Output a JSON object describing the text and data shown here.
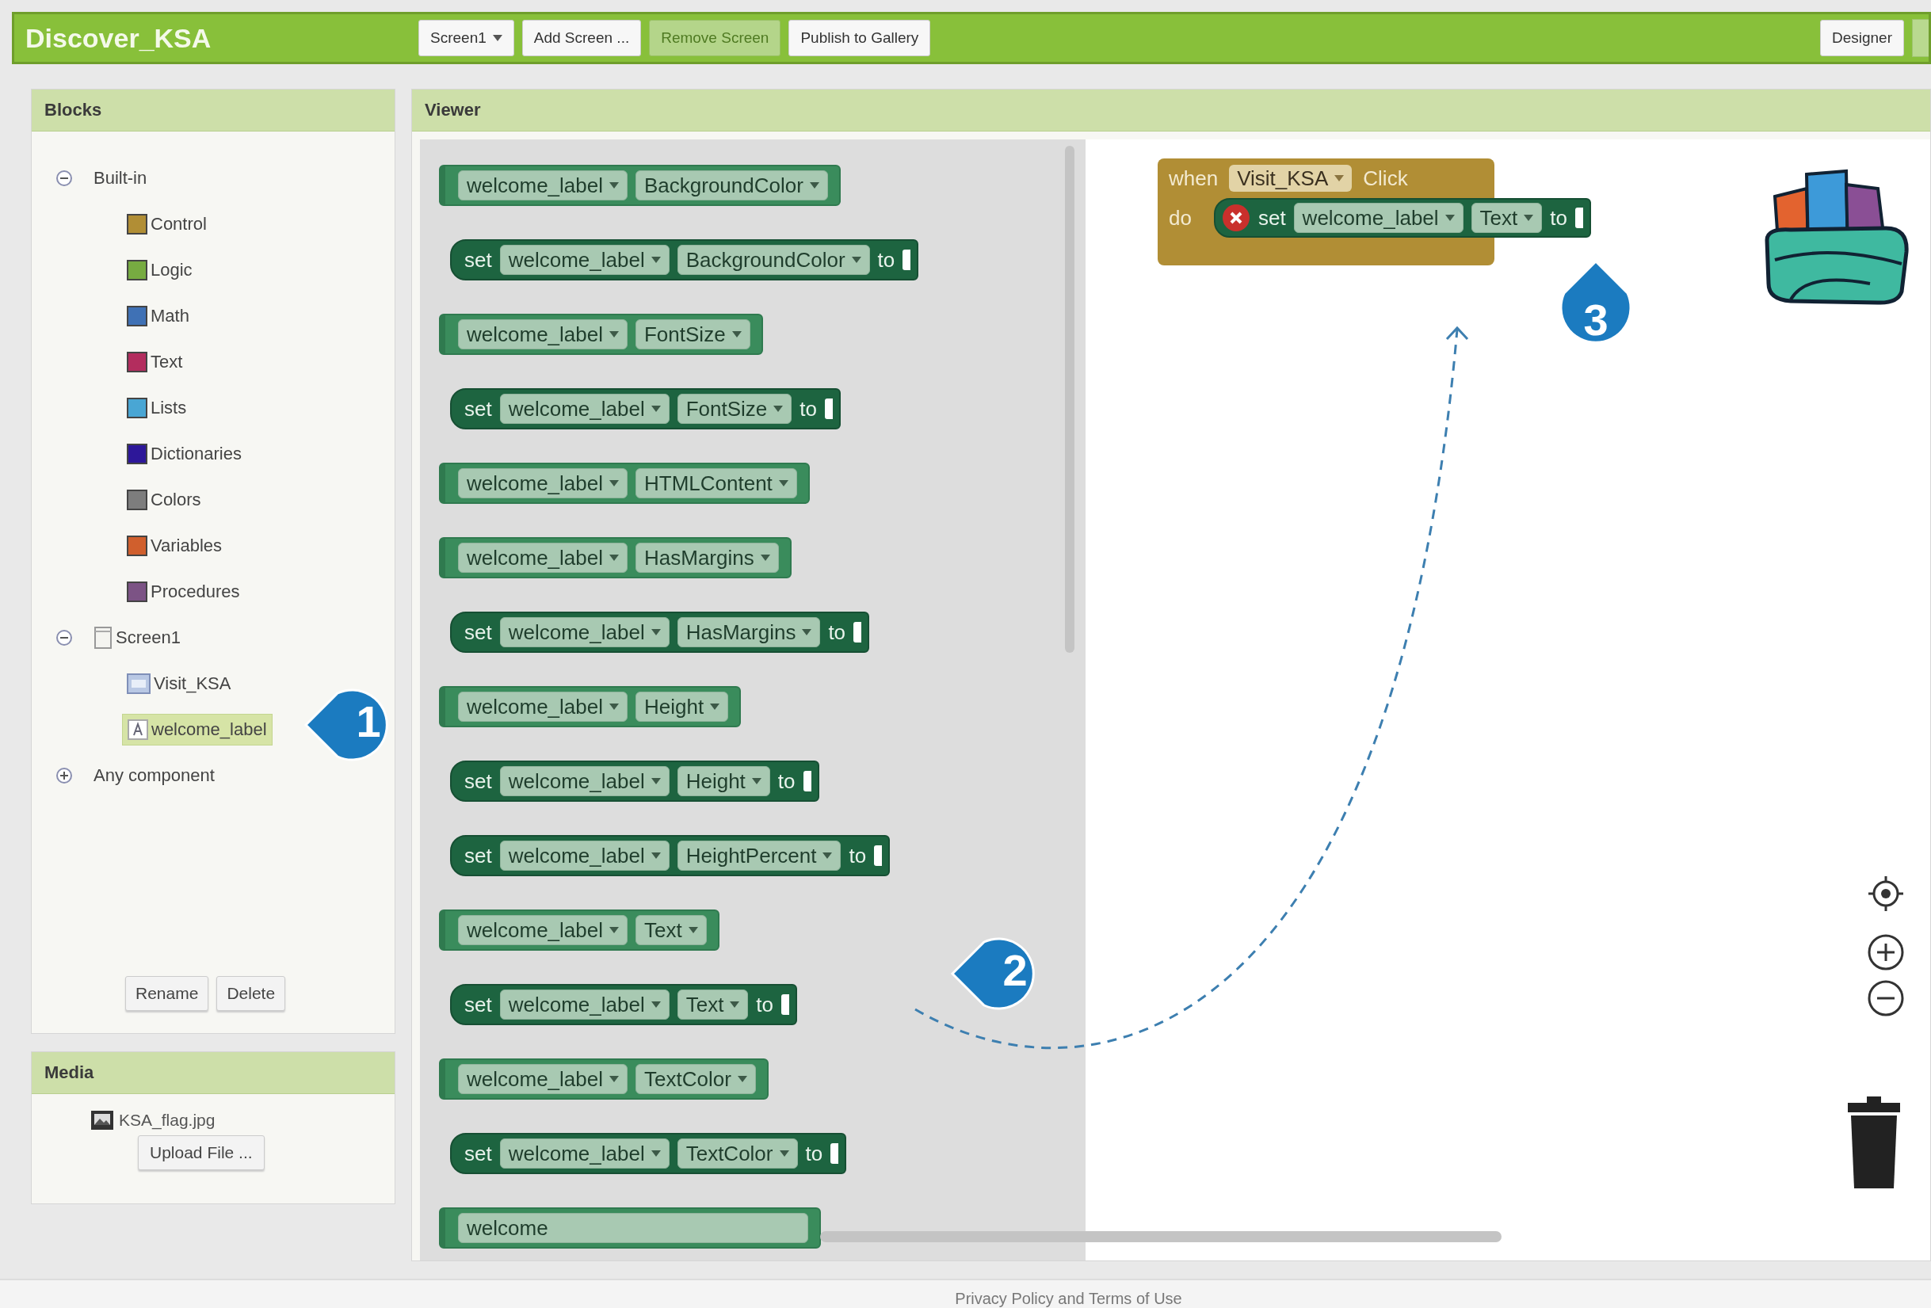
{
  "top_bar": {
    "app_title": "Discover_KSA",
    "buttons": [
      {
        "label": "Screen1",
        "kind": "dropdown",
        "disabled": false
      },
      {
        "label": "Add Screen ...",
        "kind": "plain",
        "disabled": false
      },
      {
        "label": "Remove Screen",
        "kind": "plain",
        "disabled": true
      },
      {
        "label": "Publish to Gallery",
        "kind": "plain",
        "disabled": false
      }
    ],
    "right_buttons": [
      {
        "label": "Designer",
        "kind": "plain",
        "disabled": false
      }
    ]
  },
  "blocks_panel": {
    "title": "Blocks",
    "tree": [
      {
        "label": "Built-in",
        "kind": "group",
        "expanded": true,
        "selected": false,
        "children": [
          {
            "label": "Control",
            "kind": "category",
            "color": "#b18e35",
            "selected": false
          },
          {
            "label": "Logic",
            "kind": "category",
            "color": "#77ab41",
            "selected": false
          },
          {
            "label": "Math",
            "kind": "category",
            "color": "#3f71b5",
            "selected": false
          },
          {
            "label": "Text",
            "kind": "category",
            "color": "#b32d5e",
            "selected": false
          },
          {
            "label": "Lists",
            "kind": "category",
            "color": "#49a6d4",
            "selected": false
          },
          {
            "label": "Dictionaries",
            "kind": "category",
            "color": "#2d1799",
            "selected": false
          },
          {
            "label": "Colors",
            "kind": "category",
            "color": "#7d7d7d",
            "selected": false
          },
          {
            "label": "Variables",
            "kind": "category",
            "color": "#d05f2d",
            "selected": false
          },
          {
            "label": "Procedures",
            "kind": "category",
            "color": "#7c5385",
            "selected": false
          }
        ]
      },
      {
        "label": "Screen1",
        "kind": "screen",
        "expanded": true,
        "selected": false,
        "children": [
          {
            "label": "Visit_KSA",
            "kind": "button",
            "selected": false
          },
          {
            "label": "welcome_label",
            "kind": "label",
            "selected": true
          }
        ]
      },
      {
        "label": "Any component",
        "kind": "group",
        "expanded": false,
        "selected": false
      }
    ],
    "buttons": [
      "Rename",
      "Delete"
    ]
  },
  "media_panel": {
    "title": "Media",
    "files": [
      {
        "name": "KSA_flag.jpg"
      }
    ],
    "upload_button": "Upload File ..."
  },
  "viewer": {
    "title": "Viewer",
    "flyout_blocks": [
      {
        "kind": "getter",
        "component": "welcome_label",
        "property": "BackgroundColor"
      },
      {
        "kind": "setter",
        "set_label": "set",
        "component": "welcome_label",
        "property": "BackgroundColor",
        "to_label": "to"
      },
      {
        "kind": "getter",
        "component": "welcome_label",
        "property": "FontSize"
      },
      {
        "kind": "setter",
        "set_label": "set",
        "component": "welcome_label",
        "property": "FontSize",
        "to_label": "to"
      },
      {
        "kind": "getter",
        "component": "welcome_label",
        "property": "HTMLContent"
      },
      {
        "kind": "getter",
        "component": "welcome_label",
        "property": "HasMargins"
      },
      {
        "kind": "setter",
        "set_label": "set",
        "component": "welcome_label",
        "property": "HasMargins",
        "to_label": "to"
      },
      {
        "kind": "getter",
        "component": "welcome_label",
        "property": "Height"
      },
      {
        "kind": "setter",
        "set_label": "set",
        "component": "welcome_label",
        "property": "Height",
        "to_label": "to"
      },
      {
        "kind": "setter",
        "set_label": "set",
        "component": "welcome_label",
        "property": "HeightPercent",
        "to_label": "to"
      },
      {
        "kind": "getter",
        "component": "welcome_label",
        "property": "Text"
      },
      {
        "kind": "setter",
        "set_label": "set",
        "component": "welcome_label",
        "property": "Text",
        "to_label": "to"
      },
      {
        "kind": "getter",
        "component": "welcome_label",
        "property": "TextColor"
      },
      {
        "kind": "setter",
        "set_label": "set",
        "component": "welcome_label",
        "property": "TextColor",
        "to_label": "to"
      },
      {
        "kind": "cut",
        "component": "welcome"
      }
    ],
    "event_block": {
      "when_label": "when",
      "component": "Visit_KSA",
      "event": "Click",
      "do_label": "do",
      "statement": {
        "set_label": "set",
        "component": "welcome_label",
        "property": "Text",
        "to_label": "to",
        "error": true
      }
    },
    "callouts": [
      {
        "number": "1",
        "kind": "point-left"
      },
      {
        "number": "2",
        "kind": "point-left"
      },
      {
        "number": "3",
        "kind": "point-up"
      }
    ]
  },
  "footer": {
    "text": "Privacy Policy and Terms of Use"
  }
}
